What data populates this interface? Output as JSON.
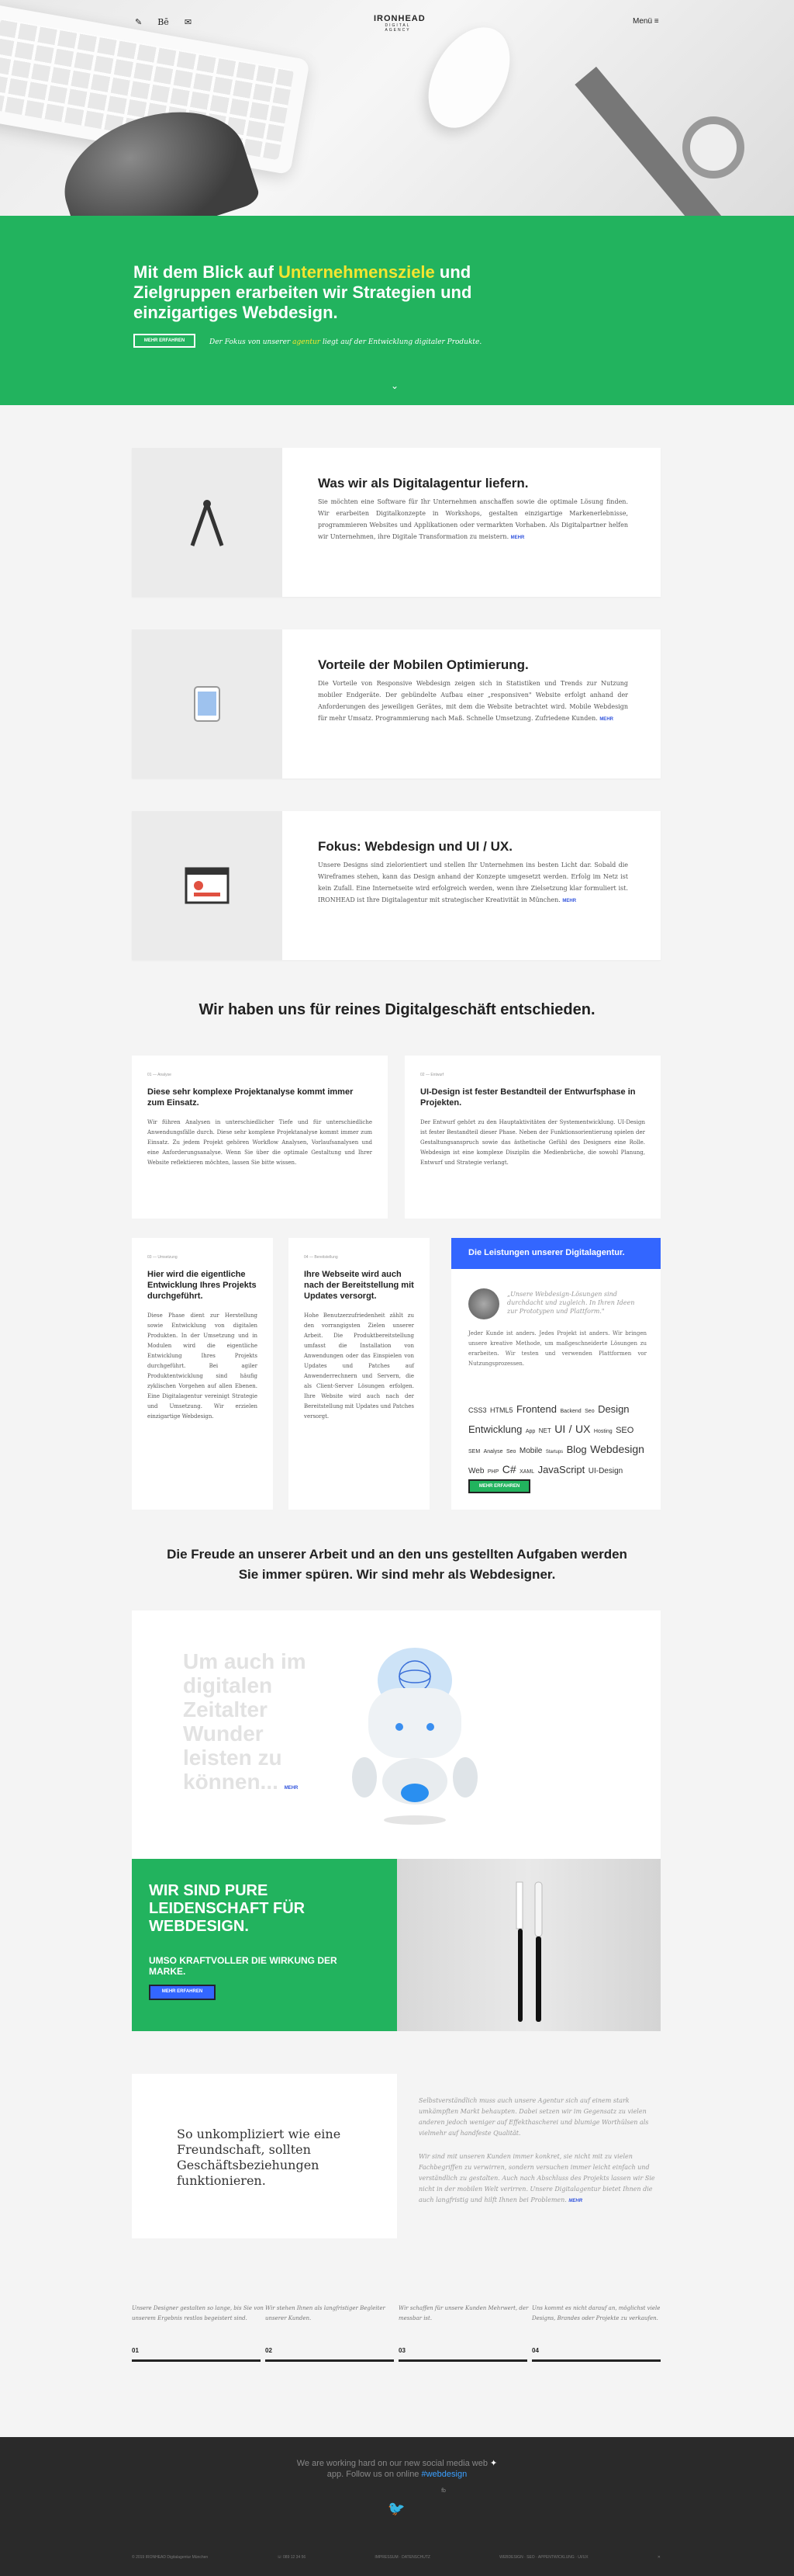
{
  "header": {
    "logo": "IRONHEAD",
    "logo_sub": "DIGITAL AGENCY",
    "menu": "Menü ≡",
    "icons": [
      "tools-icon",
      "behance-icon",
      "mail-icon"
    ],
    "icon_glyphs": [
      "✎",
      "Bē",
      "✉"
    ]
  },
  "hero_banner": {
    "title_pre": "Mit dem Blick auf ",
    "title_hl": "Unternehmensziele",
    "title_post": " und Zielgruppen erarbeiten wir Strategien und einzigartiges Webdesign.",
    "button": "MEHR ERFAHREN",
    "note_pre": "Der Fokus von unserer ",
    "note_hl": "agentur",
    "note_post": " liegt auf der Entwicklung digitaler Produkte.",
    "chevron": "⌄",
    "accent": "#22b35e",
    "highlight": "#f5e530"
  },
  "features": [
    {
      "title": "Was wir als Digitalagentur liefern.",
      "text": "Sie möchten eine Software für Ihr Unternehmen anschaffen sowie die optimale Lösung finden. Wir erarbeiten Digitalkonzepte in Workshops, gestalten einzigartige Markenerlebnisse, programmieren Websites und Applikationen oder vermarkten Vorhaben. Als Digitalpartner helfen wir Unternehmen, ihre Digitale Transformation zu meistern.",
      "more": "MEHR"
    },
    {
      "title": "Vorteile der Mobilen Optimierung.",
      "text": "Die Vorteile von Responsive Webdesign zeigen sich in Statistiken und Trends zur Nutzung mobiler Endgeräte. Der gebündelte Aufbau einer „responsiven\" Website erfolgt anhand der Anforderungen des jeweiligen Gerätes, mit dem die Website betrachtet wird. Mobile Webdesign für mehr Umsatz. Programmierung nach Maß. Schnelle Umsetzung. Zufriedene Kunden.",
      "more": "MEHR"
    },
    {
      "title": "Fokus: Webdesign und UI / UX.",
      "text": "Unsere Designs sind zielorientiert und stellen Ihr Unternehmen ins besten Licht dar. Sobald die Wireframes stehen, kann das Design anhand der Konzepte umgesetzt werden. Erfolg im Netz ist kein Zufall. Eine Internetseite wird erfolgreich werden, wenn ihre Zielsetzung klar formuliert ist. IRONHEAD ist Ihre Digitalagentur mit strategischer Kreativität in München.",
      "more": "MEHR"
    }
  ],
  "section_title": "Wir haben uns für reines Digitalgeschäft entschieden.",
  "cards": [
    {
      "tag": "01 — Analyse",
      "title": "Diese sehr komplexe Projektanalyse kommt immer zum Einsatz.",
      "text": "Wir führen Analysen in unterschiedlicher Tiefe und für unterschiedliche Anwendungsfälle durch. Diese sehr komplexe Projektanalyse kommt immer zum Einsatz. Zu jedem Projekt gehören Workflow Analysen, Vorlaufsanalysen und eine Anforderungsanalyse. Wenn Sie über die optimale Gestaltung und Ihrer Website reflektieren möchten, lassen Sie bitte wissen."
    },
    {
      "tag": "02 — Entwurf",
      "title": "UI-Design ist fester Bestandteil der Entwurfsphase in Projekten.",
      "text": "Der Entwurf gehört zu den Hauptaktivitäten der Systementwicklung. UI-Design ist fester Bestandteil dieser Phase. Neben der Funktionsorientierung spielen der Gestaltungsanspruch sowie das ästhetische Gefühl des Designers eine Rolle. Webdesign ist eine komplexe Disziplin die Medienbrüche, die sowohl Planung, Entwurf und Strategie verlangt."
    },
    {
      "tag": "03 — Umsetzung",
      "title": "Hier wird die eigentliche Entwicklung Ihres Projekts durchgeführt.",
      "text": "Diese Phase dient zur Herstellung sowie Entwicklung von digitalen Produkten. In der Umsetzung und in Modulen wird die eigentliche Entwicklung Ihres Projekts durchgeführt. Bei agiler Produktentwicklung sind häufig zyklischen Vorgehen auf allen Ebenen. Eine Digitalagentur vereinigt Strategie und Umsetzung. Wir erzielen einzigartige Webdesign."
    },
    {
      "tag": "04 — Bereitstellung",
      "title": "Ihre Webseite wird auch nach der Bereitstellung mit Updates versorgt.",
      "text": "Hohe Benutzerzufriedenheit zählt zu den vorrangigsten Zielen unserer Arbeit. Die Produktbereitstellung umfasst die Installation von Anwendungen oder das Einspielen von Updates und Patches auf Anwenderrechnern und Servern, die als Client-Server Lösungen erfolgen. Ihre Website wird auch nach der Bereitstellung mit Updates und Patches versorgt."
    }
  ],
  "services": {
    "title": "Die Leistungen unserer Digitalagentur.",
    "quote": "„Unsere Webdesign-Lösungen sind durchdacht und zugleich. In Ihren Ideen zur Prototypen und Plattform.\"",
    "text": "Jeder Kunde ist anders. Jedes Projekt ist anders. Wir bringen unsere kreative Methode, um maßgeschneiderte Lösungen zu erarbeiten. Wir testen und verwenden Plattformen vor Nutzungsprozessen.",
    "tags": [
      "CSS3",
      "HTML5",
      "Frontend",
      "Backend",
      "Seo",
      "Design",
      "Entwicklung",
      "App",
      "NET",
      "UI",
      "/",
      "UX",
      "Hosting",
      "SEO",
      "SEM",
      "Analyse",
      "Seo",
      "Mobile",
      "Startups",
      "Blog",
      "Webdesign",
      "Web",
      "PHP",
      "C#",
      "XAML",
      "JavaScript",
      "UI-Design"
    ],
    "button": "MEHR ERFAHREN"
  },
  "section_title2": "Die Freude an unserer Arbeit und an den uns gestellten Aufgaben werden Sie immer spüren. Wir sind mehr als Webdesigner.",
  "robot": {
    "text": "Um auch im digitalen Zeitalter Wunder leisten zu können...",
    "more": "MEHR"
  },
  "passion": {
    "title": "WIR SIND PURE LEIDENSCHAFT FÜR WEBDESIGN.",
    "sub": "UMSO KRAFTVOLLER DIE WIRKUNG DER MARKE.",
    "button": "MEHR ERFAHREN"
  },
  "friend": {
    "title": "So unkompliziert wie eine Freundschaft, sollten Geschäftsbeziehungen funktionieren.",
    "p1": "Selbstverständlich muss auch unsere Agentur sich auf einem stark umkämpften Markt behaupten. Dabei setzen wir im Gegensatz zu vielen anderen jedoch weniger auf Effekthascherei und blumige Worthülsen als vielmehr auf handfeste Qualität.",
    "p2": "Wir sind mit unseren Kunden immer konkret, sie nicht mit zu vielen Fachbegriffen zu verwirren, sondern versuchen immer leicht einfach und verständlich zu gestalten. Auch nach Abschluss des Projekts lassen wir Sie nicht in der mobilen Welt verirren. Unsere Digitalagentur bietet Ihnen die auch langfristig und hilft Ihnen bei Problemen.",
    "more": "MEHR"
  },
  "columns": [
    {
      "text": "Unsere Designer gestalten so lange, bis Sie von unserem Ergebnis restlos begeistert sind.",
      "num": "01"
    },
    {
      "text": "Wir stehen Ihnen als langfristiger Begleiter unserer Kunden.",
      "num": "02"
    },
    {
      "text": "Wir schaffen für unsere Kunden Mehrwert, der messbar ist.",
      "num": "03"
    },
    {
      "text": "Uns kommt es nicht darauf an, möglichst viele Designs, Brandes oder Projekte zu verkaufen.",
      "num": "04"
    }
  ],
  "footer": {
    "tweet_line1": "We are working hard on our new social media web",
    "tweet_line2_pre": "app. Follow us on online ",
    "tweet_link": "#webdesign",
    "tweet_tag": "fb",
    "bird": "🐦",
    "links": [
      "© 2019 IRONHEAD Digitalagentur München",
      "☏ 089 12 34 56",
      "IMPRESSUM · DATENSCHUTZ",
      "WEBDESIGN · SEO · APPENTWICKLUNG · UI/UX",
      "✕"
    ]
  }
}
